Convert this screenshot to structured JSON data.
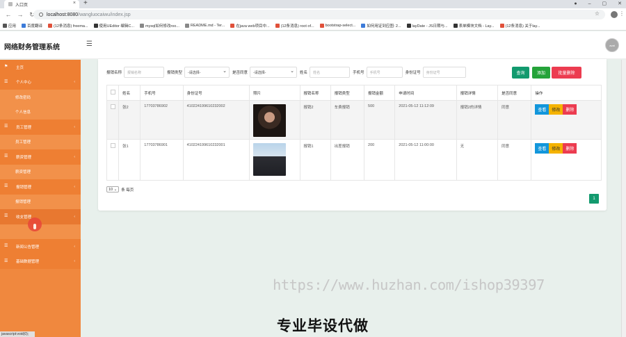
{
  "browser": {
    "tab_title": "入口页",
    "url_host": "localhost:8080",
    "url_path": "/wangluocaiwu/index.jsp",
    "bookmarks": [
      {
        "label": "应用",
        "icon": "grid"
      },
      {
        "label": "百度翻译",
        "icon": "blue"
      },
      {
        "label": "(12条消息) freema...",
        "icon": "red"
      },
      {
        "label": "使用UEditor 编辑C...",
        "icon": "dark"
      },
      {
        "label": "mysql如何修改roo...",
        "icon": "gray"
      },
      {
        "label": "README.md - Ter...",
        "icon": "gray"
      },
      {
        "label": "在java web项目中...",
        "icon": "red"
      },
      {
        "label": "(12条消息) root of...",
        "icon": "red"
      },
      {
        "label": "bootstrap-select...",
        "icon": "red"
      },
      {
        "label": "如何用证到应图: 2...",
        "icon": "blue"
      },
      {
        "label": "layDate - JS日期与...",
        "icon": "dark"
      },
      {
        "label": "表单模块文档 - Lay...",
        "icon": "dark"
      },
      {
        "label": "(12条消息) 关于lay...",
        "icon": "red"
      }
    ]
  },
  "app": {
    "title": "网络财务管理系统",
    "avatar_text": "avat"
  },
  "sidebar": {
    "items": [
      {
        "label": "主页",
        "type": "flag"
      },
      {
        "label": "个人中心",
        "type": "parent"
      },
      {
        "label": "修改密码",
        "type": "sub"
      },
      {
        "label": "个人信息",
        "type": "sub"
      },
      {
        "label": "员工管理",
        "type": "parent"
      },
      {
        "label": "员工管理",
        "type": "sub"
      },
      {
        "label": "薪资管理",
        "type": "parent"
      },
      {
        "label": "薪资管理",
        "type": "sub"
      },
      {
        "label": "报销管理",
        "type": "parent"
      },
      {
        "label": "报销管理",
        "type": "sub"
      },
      {
        "label": "收支管理",
        "type": "parent"
      },
      {
        "label": "",
        "type": "sub"
      },
      {
        "label": "新闻公告管理",
        "type": "parent"
      },
      {
        "label": "基础数据管理",
        "type": "parent"
      }
    ],
    "status_text": "javascript:void(0);"
  },
  "filters": {
    "name_label": "报销名称",
    "name_placeholder": "报销名称",
    "type_label": "报销类型",
    "type_value": "-请选择-",
    "agree_label": "是否同意",
    "agree_value": "-请选择-",
    "person_label": "姓名",
    "person_placeholder": "姓名",
    "phone_label": "手机号",
    "phone_placeholder": "手机号",
    "id_label": "身份证号",
    "id_placeholder": "身份证号",
    "search_btn": "查询",
    "add_btn": "添加",
    "bulk_delete_btn": "批量删除"
  },
  "table": {
    "headers": [
      "",
      "姓名",
      "手机号",
      "身份证号",
      "照片",
      "报销名称",
      "报销类型",
      "报销金额",
      "申请时间",
      "报销详情",
      "是否同意",
      "操作"
    ],
    "rows": [
      {
        "name": "张2",
        "phone": "17703786902",
        "idcard": "410224199610232002",
        "reimb_name": "报销2",
        "reimb_type": "车费报销",
        "amount": "500",
        "apply_time": "2021-05-12 11:12:09",
        "detail": "报销2的详情",
        "agree": "同意"
      },
      {
        "name": "张1",
        "phone": "17703786901",
        "idcard": "410224199610232001",
        "reimb_name": "报销1",
        "reimb_type": "出差报销",
        "amount": "200",
        "apply_time": "2021-05-12 11:00:00",
        "detail": "无",
        "agree": "同意"
      }
    ],
    "op_view": "查看",
    "op_edit": "修改",
    "op_delete": "删除"
  },
  "pager": {
    "page_size": "10",
    "page_size_suffix": "条 每页",
    "current_page": "1"
  },
  "overlay": {
    "watermark": "https://www.huzhan.com/ishop39397",
    "slogan": "专业毕设代做"
  }
}
